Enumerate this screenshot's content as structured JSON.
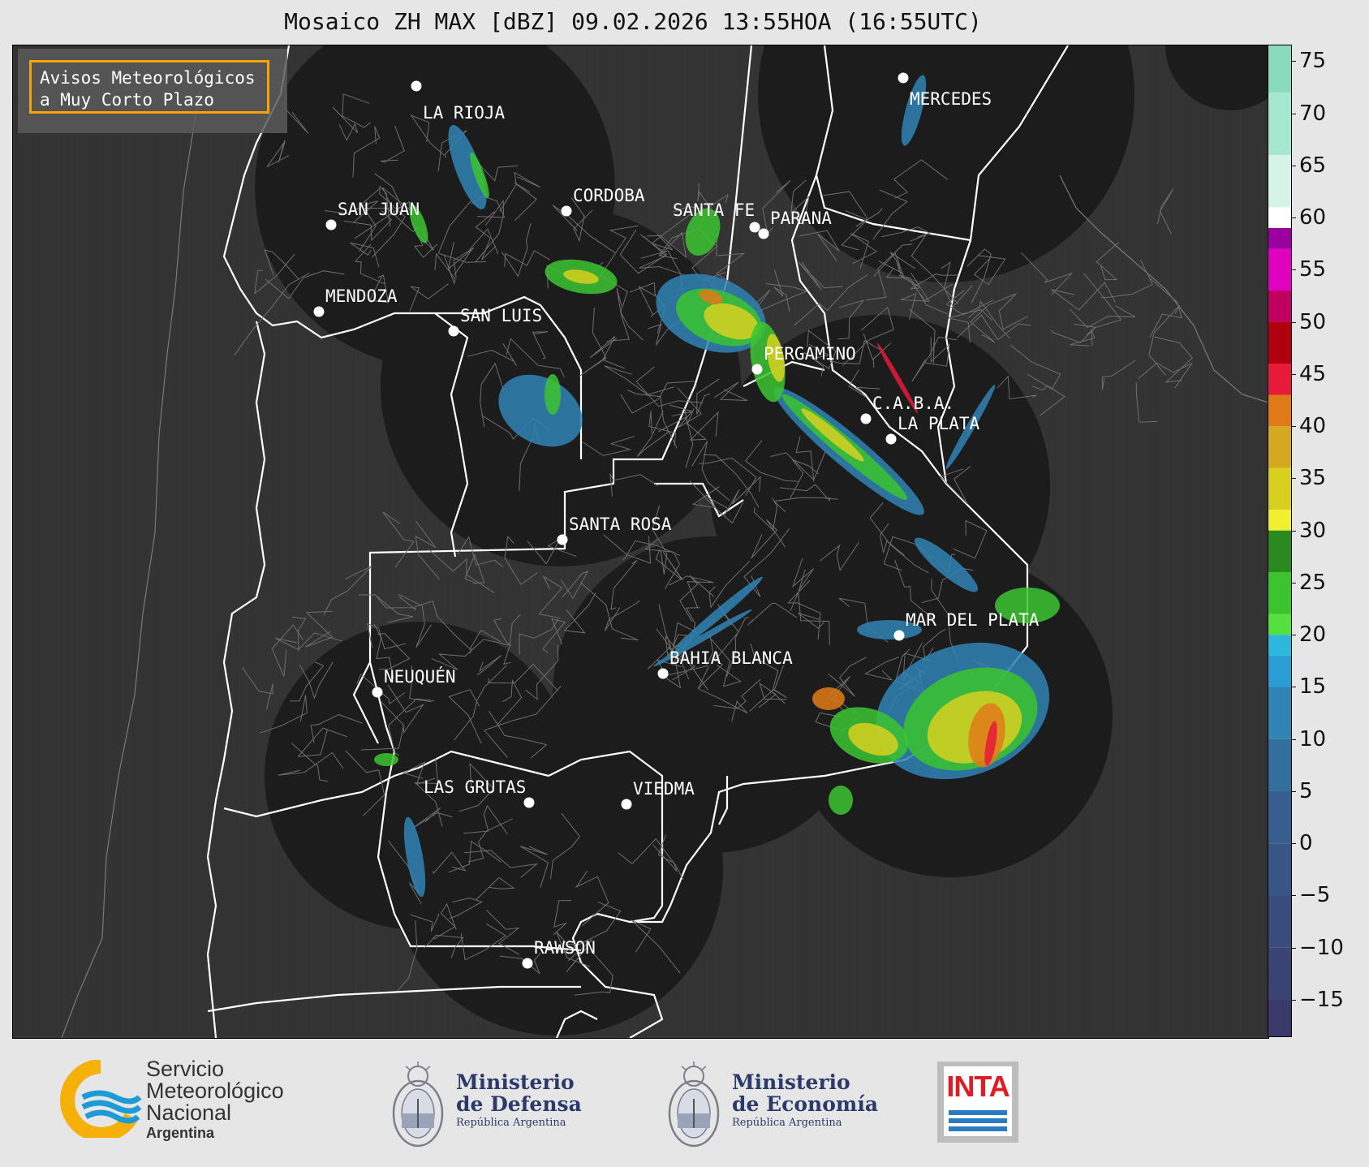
{
  "title": "Mosaico ZH MAX [dBZ] 09.02.2026 13:55HOA (16:55UTC)",
  "alert_box": {
    "line1": "Avisos Meteorológicos",
    "line2": "a Muy Corto Plazo",
    "border_color": "#f5a30a"
  },
  "cities": [
    {
      "name": "LA RIOJA"
    },
    {
      "name": "MERCEDES"
    },
    {
      "name": "CORDOBA"
    },
    {
      "name": "SAN JUAN"
    },
    {
      "name": "SANTA FE"
    },
    {
      "name": "PARANA"
    },
    {
      "name": "MENDOZA"
    },
    {
      "name": "SAN LUIS"
    },
    {
      "name": "PERGAMINO"
    },
    {
      "name": "C.A.B.A."
    },
    {
      "name": "LA PLATA"
    },
    {
      "name": "SANTA ROSA"
    },
    {
      "name": "MAR DEL PLATA"
    },
    {
      "name": "BAHIA BLANCA"
    },
    {
      "name": "NEUQUÉN"
    },
    {
      "name": "LAS GRUTAS"
    },
    {
      "name": "VIEDMA"
    },
    {
      "name": "RAWSON"
    }
  ],
  "colorbar": {
    "min": -18.5,
    "max": 76.5,
    "ticks": [
      "75",
      "70",
      "65",
      "60",
      "55",
      "50",
      "45",
      "40",
      "35",
      "30",
      "25",
      "20",
      "15",
      "10",
      "5",
      "0",
      "−5",
      "−10",
      "−15"
    ],
    "bands": [
      {
        "from": -18.5,
        "to": -15,
        "color": "#3a3a6a"
      },
      {
        "from": -15,
        "to": -10,
        "color": "#3a4373"
      },
      {
        "from": -10,
        "to": -5,
        "color": "#394c7c"
      },
      {
        "from": -5,
        "to": 0,
        "color": "#385585"
      },
      {
        "from": 0,
        "to": 5,
        "color": "#375e8e"
      },
      {
        "from": 5,
        "to": 10,
        "color": "#336f9e"
      },
      {
        "from": 10,
        "to": 15,
        "color": "#2f84b4"
      },
      {
        "from": 15,
        "to": 18,
        "color": "#2a9ed4"
      },
      {
        "from": 18,
        "to": 20,
        "color": "#2db7dd"
      },
      {
        "from": 20,
        "to": 22,
        "color": "#55e040"
      },
      {
        "from": 22,
        "to": 26,
        "color": "#3cc430"
      },
      {
        "from": 26,
        "to": 30,
        "color": "#2a8a20"
      },
      {
        "from": 30,
        "to": 32,
        "color": "#f0f030"
      },
      {
        "from": 32,
        "to": 36,
        "color": "#d8d020"
      },
      {
        "from": 36,
        "to": 40,
        "color": "#d4a820"
      },
      {
        "from": 40,
        "to": 43,
        "color": "#e07a18"
      },
      {
        "from": 43,
        "to": 46,
        "color": "#e81a3a"
      },
      {
        "from": 46,
        "to": 50,
        "color": "#b00010"
      },
      {
        "from": 50,
        "to": 53,
        "color": "#c00060"
      },
      {
        "from": 53,
        "to": 57,
        "color": "#e000c0"
      },
      {
        "from": 57,
        "to": 59,
        "color": "#9a00a0"
      },
      {
        "from": 59,
        "to": 61,
        "color": "#ffffff"
      },
      {
        "from": 61,
        "to": 66,
        "color": "#d6f3e8"
      },
      {
        "from": 66,
        "to": 72,
        "color": "#a6e8cf"
      },
      {
        "from": 72,
        "to": 76.5,
        "color": "#88dcbb"
      }
    ]
  },
  "footer": {
    "smn": {
      "line1": "Servicio",
      "line2": "Meteorológico",
      "line3": "Nacional",
      "line4": "Argentina"
    },
    "defensa": {
      "line1": "Ministerio",
      "line2": "de Defensa",
      "line3": "República Argentina"
    },
    "economia": {
      "line1": "Ministerio",
      "line2": "de Economía",
      "line3": "República Argentina"
    },
    "inta": {
      "label": "INTA"
    }
  }
}
